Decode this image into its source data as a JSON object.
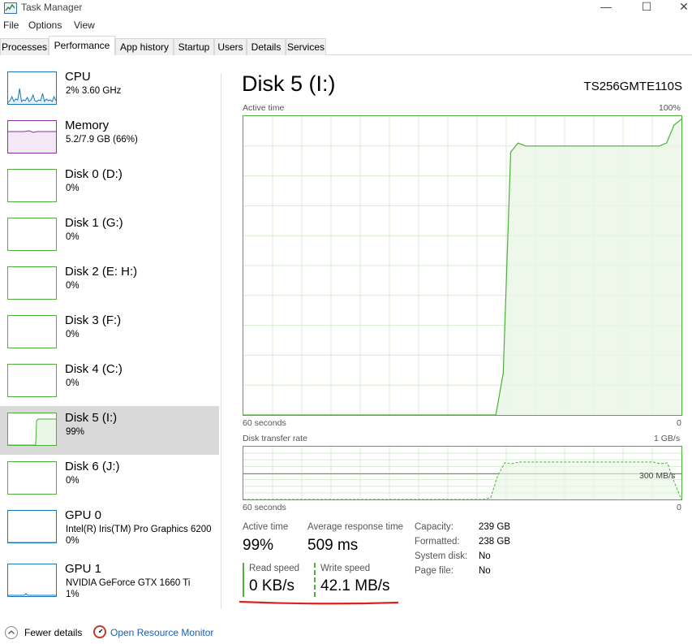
{
  "window": {
    "title": "Task Manager",
    "minimize": "—",
    "maximize": "☐",
    "close": "✕"
  },
  "menu": [
    "File",
    "Options",
    "View"
  ],
  "tabs": [
    {
      "label": "Processes",
      "active": false
    },
    {
      "label": "Performance",
      "active": true
    },
    {
      "label": "App history",
      "active": false
    },
    {
      "label": "Startup",
      "active": false
    },
    {
      "label": "Users",
      "active": false
    },
    {
      "label": "Details",
      "active": false
    },
    {
      "label": "Services",
      "active": false
    }
  ],
  "sidebar": [
    {
      "name": "CPU",
      "sub": "2% 3.60 GHz",
      "kind": "cpu",
      "color": "#1779ba",
      "fill": "#e8f1f9",
      "selected": false
    },
    {
      "name": "Memory",
      "sub": "5.2/7.9 GB (66%)",
      "kind": "memory",
      "color": "#8b2f9e",
      "fill": "#f4e8f6",
      "selected": false
    },
    {
      "name": "Disk 0 (D:)",
      "sub": "0%",
      "kind": "flat",
      "color": "#4caf3a",
      "fill": "#ffffff",
      "selected": false
    },
    {
      "name": "Disk 1 (G:)",
      "sub": "0%",
      "kind": "flat",
      "color": "#4caf3a",
      "fill": "#ffffff",
      "selected": false
    },
    {
      "name": "Disk 2 (E: H:)",
      "sub": "0%",
      "kind": "flat",
      "color": "#4caf3a",
      "fill": "#ffffff",
      "selected": false
    },
    {
      "name": "Disk 3 (F:)",
      "sub": "0%",
      "kind": "flat",
      "color": "#4caf3a",
      "fill": "#ffffff",
      "selected": false
    },
    {
      "name": "Disk 4 (C:)",
      "sub": "0%",
      "kind": "flat",
      "color": "#4caf3a",
      "fill": "#ffffff",
      "selected": false
    },
    {
      "name": "Disk 5 (I:)",
      "sub": "99%",
      "kind": "disk5",
      "color": "#4caf3a",
      "fill": "#eaf6e6",
      "selected": true
    },
    {
      "name": "Disk 6 (J:)",
      "sub": "0%",
      "kind": "flat",
      "color": "#4caf3a",
      "fill": "#ffffff",
      "selected": false
    },
    {
      "name": "GPU 0",
      "sub": "Intel(R) Iris(TM) Pro Graphics 6200\n0%",
      "kind": "gpu0",
      "color": "#1779ba",
      "fill": "#ffffff",
      "selected": false
    },
    {
      "name": "GPU 1",
      "sub": "NVIDIA GeForce GTX 1660 Ti\n1%",
      "kind": "gpu1",
      "color": "#1779ba",
      "fill": "#ffffff",
      "selected": false
    }
  ],
  "detail": {
    "title": "Disk 5 (I:)",
    "model": "TS256GMTE110S",
    "active_graph": {
      "label": "Active time",
      "max": "100%",
      "xlabel": "60 seconds",
      "min": "0"
    },
    "transfer_graph": {
      "label": "Disk transfer rate",
      "max": "1 GB/s",
      "mark": "300 MB/s",
      "xlabel": "60 seconds",
      "min": "0"
    },
    "stats": {
      "active_time_label": "Active time",
      "active_time_value": "99%",
      "response_label": "Average response time",
      "response_value": "509 ms",
      "read_label": "Read speed",
      "read_value": "0 KB/s",
      "write_label": "Write speed",
      "write_value": "42.1 MB/s"
    },
    "props": [
      {
        "label": "Capacity:",
        "value": "239 GB"
      },
      {
        "label": "Formatted:",
        "value": "238 GB"
      },
      {
        "label": "System disk:",
        "value": "No"
      },
      {
        "label": "Page file:",
        "value": "No"
      }
    ],
    "active_series": [
      0,
      0,
      0,
      0,
      0,
      0,
      0,
      0,
      0,
      0,
      0,
      0,
      0,
      0,
      0,
      0,
      0,
      0,
      0,
      0,
      0,
      0,
      0,
      0,
      0,
      0,
      0,
      0,
      0,
      0,
      0,
      0,
      0,
      0,
      0,
      14,
      88,
      91,
      90,
      90,
      90,
      90,
      90,
      90,
      90,
      90,
      90,
      90,
      90,
      90,
      90,
      90,
      90,
      90,
      90,
      90,
      90,
      91,
      97,
      99
    ],
    "transfer_series": [
      0,
      0,
      0,
      0,
      0,
      0,
      0,
      0,
      0,
      0,
      0,
      0,
      0,
      0,
      0,
      0,
      0,
      0,
      0,
      0,
      0,
      0,
      0,
      0,
      0,
      0,
      0,
      0,
      0,
      0,
      0,
      0,
      0,
      0,
      0,
      2,
      28,
      43,
      42,
      44,
      44,
      44,
      44,
      44,
      44,
      44,
      44,
      44,
      44,
      44,
      44,
      44,
      44,
      44,
      44,
      44,
      44,
      44,
      44,
      42,
      43,
      20,
      0
    ],
    "read_series": [
      0,
      0,
      0,
      0,
      0,
      0,
      0,
      0,
      0,
      0,
      0,
      0,
      0,
      0,
      0,
      0,
      0,
      0,
      0,
      0,
      0,
      0,
      0,
      0,
      0,
      0,
      0,
      0,
      0,
      0,
      0,
      0,
      0,
      0,
      0,
      2,
      28,
      43,
      42,
      44,
      44,
      44,
      44,
      44,
      44,
      44,
      44,
      44,
      44,
      44,
      44,
      44,
      44,
      44,
      44,
      44,
      44,
      44,
      44,
      42,
      43,
      20,
      0
    ]
  },
  "footer": {
    "fewer": "Fewer details",
    "monitor": "Open Resource Monitor"
  },
  "colors": {
    "disk_green": "#4caf3a",
    "disk_fill": "#eaf6e6",
    "grid": "#d8ecd3",
    "red_underline": "#e02020"
  }
}
